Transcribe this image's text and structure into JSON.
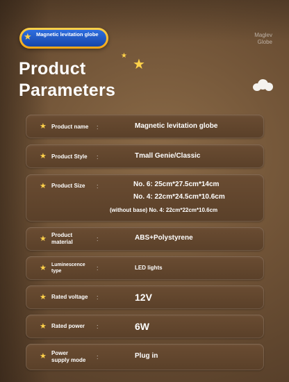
{
  "badge": {
    "text": "Magnetic levitation globe"
  },
  "brand": {
    "line1": "Maglev",
    "line2": "Globe"
  },
  "title": {
    "line1": "Product",
    "line2": "Parameters"
  },
  "params": {
    "name": {
      "label": "Product name",
      "value": "Magnetic levitation globe"
    },
    "style": {
      "label": "Product Style",
      "value": "Tmall Genie/Classic"
    },
    "size": {
      "label": "Product Size",
      "value1": "No. 6: 25cm*27.5cm*14cm",
      "value2": "No. 4: 22cm*24.5cm*10.6cm",
      "value3": "(without base) No. 4: 22cm*22cm*10.6cm"
    },
    "material": {
      "label_line1": "Product",
      "label_line2": "material",
      "value": "ABS+Polystyrene"
    },
    "luminescence": {
      "label_line1": "Luminescence",
      "label_line2": "type",
      "value": "LED lights"
    },
    "voltage": {
      "label": "Rated voltage",
      "value": "12V"
    },
    "power": {
      "label": "Rated power",
      "value": "6W"
    },
    "supply": {
      "label_line1": "Power",
      "label_line2": "supply mode",
      "value": "Plug in"
    },
    "colon": ":"
  },
  "icons": {
    "row_marker": "star-icon",
    "decoration": [
      "star-icon",
      "cloud-icon"
    ]
  },
  "colors": {
    "accent": "#ffd24a",
    "badge_blue": "#1f55c4",
    "background": "#6f5236",
    "row": "#5f442c"
  }
}
